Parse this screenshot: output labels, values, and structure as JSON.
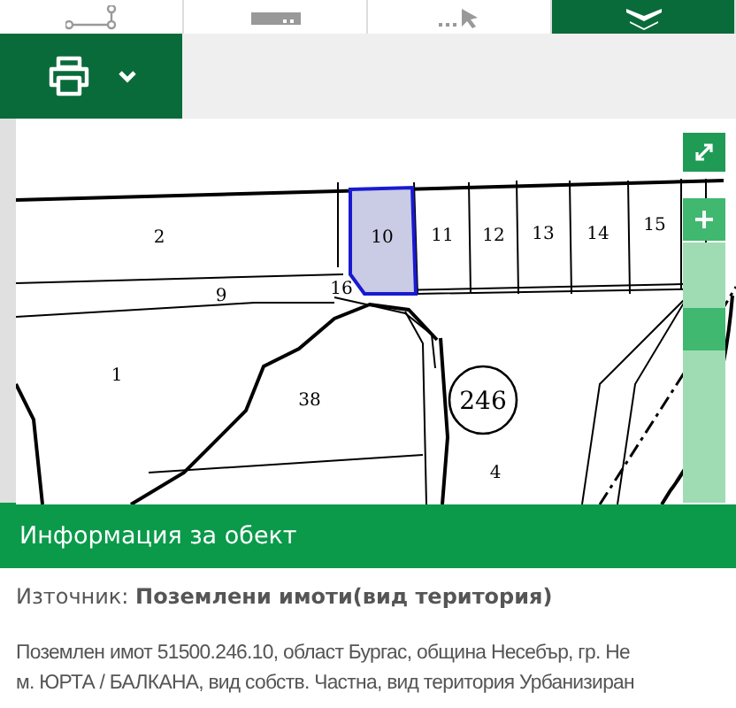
{
  "toolbar_tabs": [
    {
      "kind": "polyline",
      "selected": false
    },
    {
      "kind": "screen",
      "selected": false
    },
    {
      "kind": "select",
      "selected": false
    },
    {
      "kind": "layers",
      "selected": true
    }
  ],
  "print_menu": {
    "expanded": false
  },
  "map": {
    "parcels": [
      {
        "label": "2",
        "selected": false
      },
      {
        "label": "10",
        "selected": true
      },
      {
        "label": "11",
        "selected": false
      },
      {
        "label": "12",
        "selected": false
      },
      {
        "label": "13",
        "selected": false
      },
      {
        "label": "14",
        "selected": false
      },
      {
        "label": "15",
        "selected": false
      },
      {
        "label": "9",
        "selected": false
      },
      {
        "label": "16",
        "selected": false
      },
      {
        "label": "1",
        "selected": false
      },
      {
        "label": "38",
        "selected": false
      },
      {
        "label": "4",
        "selected": false
      }
    ],
    "block_number": "246",
    "zoom": {
      "level": 0.67
    }
  },
  "info_panel": {
    "title": "Информация за обект",
    "source_label": "Източник:",
    "source_value": "Поземлени имоти(вид територия)",
    "lines": [
      "Поземлен имот 51500.246.10, област Бургас, община Несебър, гр. Не",
      "м. ЮРТА / БАЛКАНА, вид собств. Частна, вид територия Урбанизиран"
    ]
  }
}
